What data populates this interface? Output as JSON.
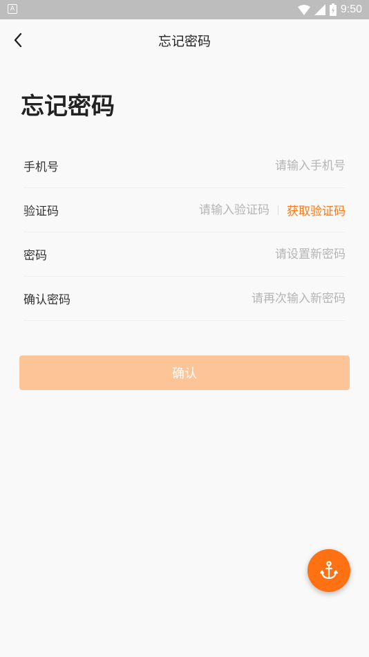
{
  "status_bar": {
    "app_icon_letter": "A",
    "time": "9:50",
    "icons": [
      "wifi-icon",
      "signal-icon",
      "battery-icon"
    ]
  },
  "nav": {
    "back_icon": "chevron-left-icon",
    "title": "忘记密码"
  },
  "page": {
    "title": "忘记密码"
  },
  "form": {
    "phone": {
      "label": "手机号",
      "placeholder": "请输入手机号",
      "value": ""
    },
    "code": {
      "label": "验证码",
      "placeholder": "请输入验证码",
      "value": "",
      "get_code_label": "获取验证码"
    },
    "password": {
      "label": "密码",
      "placeholder": "请设置新密码",
      "value": ""
    },
    "confirm_password": {
      "label": "确认密码",
      "placeholder": "请再次输入新密码",
      "value": ""
    }
  },
  "confirm_button": {
    "label": "确认"
  },
  "fab": {
    "icon": "anchor-icon"
  },
  "colors": {
    "accent": "#ff7a12",
    "button_disabled": "#fcc497",
    "fab": "#ff7112",
    "status_bar": "#bdbdbd",
    "background": "#f9f9f9"
  }
}
